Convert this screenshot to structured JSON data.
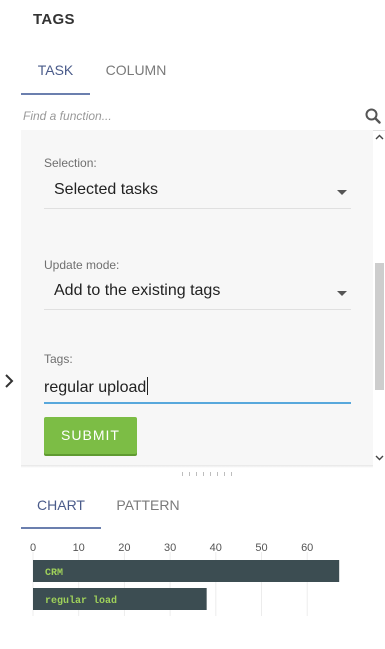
{
  "header": {
    "title": "TAGS"
  },
  "tabs": [
    {
      "label": "TASK",
      "active": true
    },
    {
      "label": "COLUMN",
      "active": false
    }
  ],
  "search": {
    "placeholder": "Find a function..."
  },
  "form": {
    "selection_label": "Selection:",
    "selection_value": "Selected tasks",
    "update_mode_label": "Update mode:",
    "update_mode_value": "Add to the existing tags",
    "tags_label": "Tags:",
    "tags_value": "regular upload",
    "submit_label": "SUBMIT"
  },
  "bottom_tabs": [
    {
      "label": "CHART",
      "active": true
    },
    {
      "label": "PATTERN",
      "active": false
    }
  ],
  "colors": {
    "accent": "#6b7fae",
    "submit": "#7cbd45",
    "bar": "#3c4d52",
    "bar_text": "#9fd15a",
    "focus": "#58a8dc"
  },
  "chart_data": {
    "type": "bar",
    "orientation": "horizontal",
    "categories": [
      "CRM",
      "regular load"
    ],
    "values": [
      67,
      38
    ],
    "xticks": [
      0,
      10,
      20,
      30,
      40,
      50,
      60
    ],
    "xlim": [
      0,
      67
    ],
    "grid": true
  }
}
